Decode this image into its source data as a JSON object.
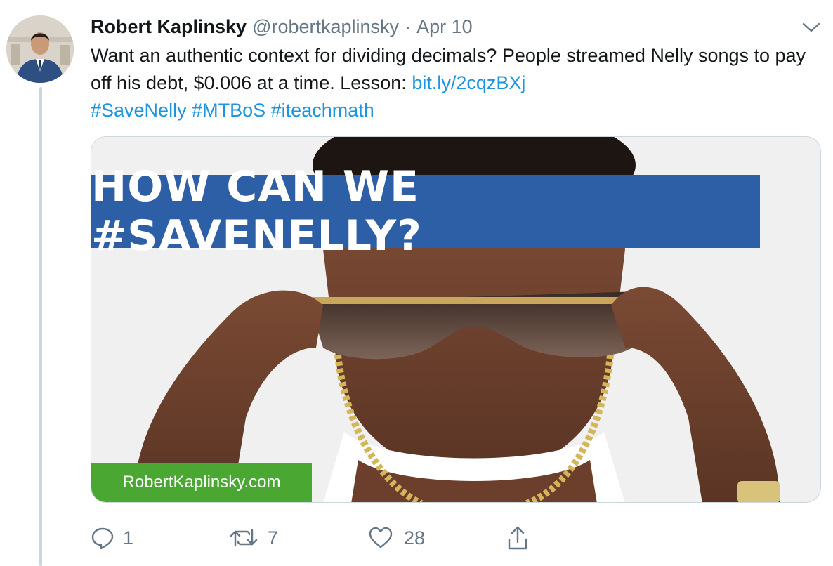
{
  "tweet": {
    "author_name": "Robert Kaplinsky",
    "handle": "@robertkaplinsky",
    "separator": "·",
    "date": "Apr 10",
    "text_plain": "Want an authentic context for dividing decimals? People streamed Nelly songs to pay off his debt, $0.006 at a time. Lesson: ",
    "link": "bit.ly/2cqzBXj",
    "hashtags": [
      "#SaveNelly",
      "#MTBoS",
      "#iteachmath"
    ]
  },
  "media": {
    "banner_text": "HOW CAN WE #SAVENELLY?",
    "site_label": "RobertKaplinsky.com"
  },
  "actions": {
    "reply_count": "1",
    "retweet_count": "7",
    "like_count": "28"
  },
  "icons": {
    "reply": "reply-icon",
    "retweet": "retweet-icon",
    "like": "heart-icon",
    "share": "share-icon",
    "more": "chevron-down-icon"
  },
  "colors": {
    "link": "#1b95e0",
    "muted": "#657786",
    "banner": "#2d5fa7",
    "badge": "#4aa832"
  }
}
